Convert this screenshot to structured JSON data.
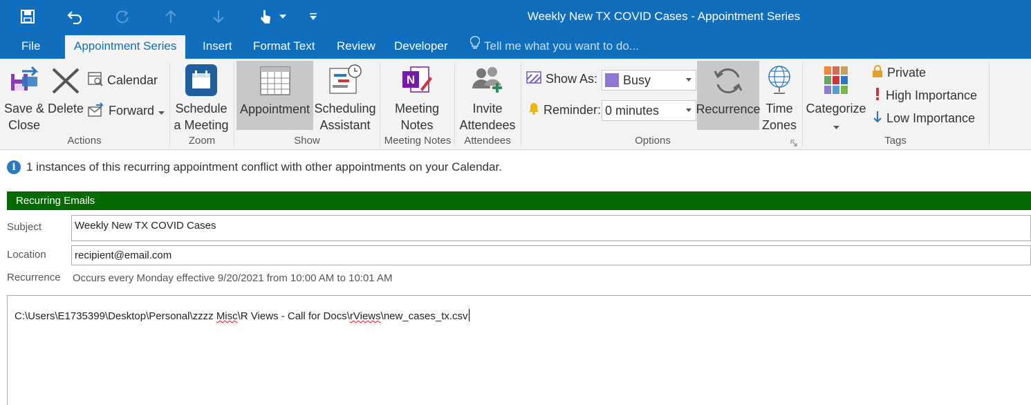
{
  "window": {
    "title": "Weekly New TX COVID Cases - Appointment Series"
  },
  "quick_access": {
    "icons": [
      "save-icon",
      "undo-icon",
      "redo-icon",
      "up-arrow-icon",
      "down-arrow-icon",
      "touch-mode-icon",
      "customize-qat-icon"
    ]
  },
  "tabs": [
    {
      "label": "File"
    },
    {
      "label": "Appointment Series",
      "active": true
    },
    {
      "label": "Insert"
    },
    {
      "label": "Format Text"
    },
    {
      "label": "Review"
    },
    {
      "label": "Developer"
    }
  ],
  "tell_me": {
    "placeholder": "Tell me what you want to do..."
  },
  "ribbon": {
    "actions": {
      "label": "Actions",
      "save_close": {
        "line1": "Save &",
        "line2": "Close"
      },
      "delete": "Delete",
      "calendar": "Calendar",
      "forward": "Forward"
    },
    "zoom": {
      "label": "Zoom",
      "schedule": {
        "line1": "Schedule",
        "line2": "a Meeting"
      }
    },
    "show": {
      "label": "Show",
      "appointment": "Appointment",
      "scheduling": {
        "line1": "Scheduling",
        "line2": "Assistant"
      }
    },
    "meeting_notes": {
      "label": "Meeting Notes",
      "button": {
        "line1": "Meeting",
        "line2": "Notes"
      }
    },
    "attendees": {
      "label": "Attendees",
      "button": {
        "line1": "Invite",
        "line2": "Attendees"
      }
    },
    "options": {
      "label": "Options",
      "show_as_label": "Show As:",
      "show_as_value": "Busy",
      "reminder_label": "Reminder:",
      "reminder_value": "0 minutes",
      "recurrence": "Recurrence",
      "time_zones": {
        "line1": "Time",
        "line2": "Zones"
      }
    },
    "tags": {
      "label": "Tags",
      "categorize": "Categorize",
      "private": "Private",
      "high_importance": "High Importance",
      "low_importance": "Low Importance"
    }
  },
  "colors": {
    "brand_blue": "#106ebe",
    "category_green": "#056b02",
    "busy_purple": "#8e78d4",
    "importance_red": "#d13438",
    "info_blue": "#2b79c2"
  },
  "info_bar": {
    "message": "1 instances of this recurring appointment conflict with other appointments on your Calendar."
  },
  "category_bar": {
    "label": "Recurring Emails"
  },
  "form": {
    "subject_label": "Subject",
    "subject_value": "Weekly New TX COVID Cases",
    "location_label": "Location",
    "location_value": "recipient@email.com",
    "recurrence_label": "Recurrence",
    "recurrence_value": "Occurs every Monday effective 9/20/2021 from 10:00 AM to 10:01 AM"
  },
  "body": {
    "parts": [
      "C:\\Users\\E1735399\\Desktop\\Personal\\zzzz ",
      "Misc",
      "\\R Views - Call for Docs\\",
      "rViews",
      "\\new_cases_tx.csv"
    ]
  }
}
